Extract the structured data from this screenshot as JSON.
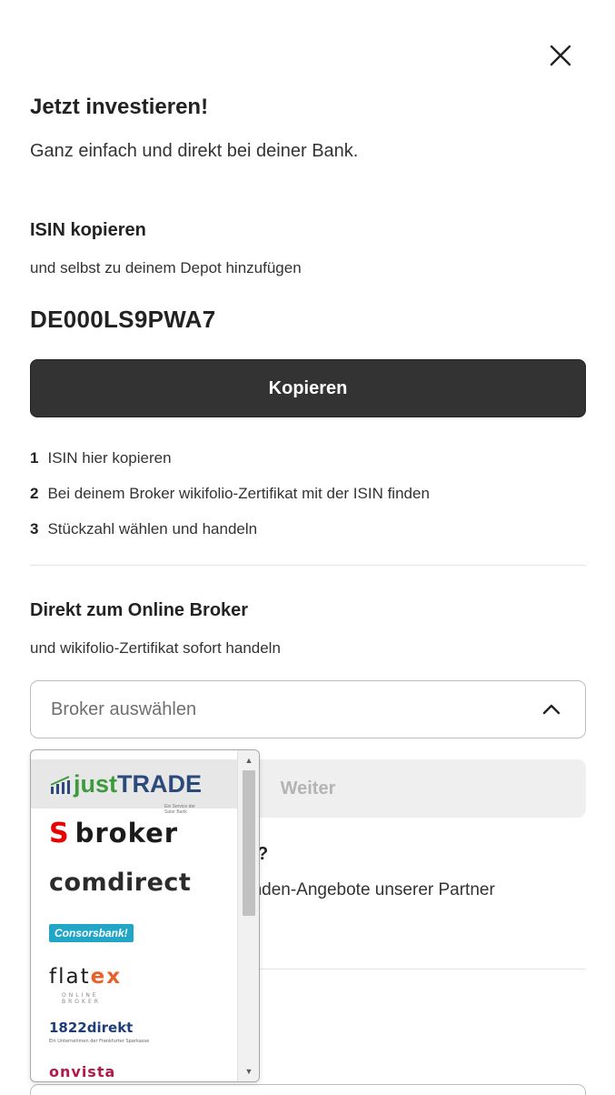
{
  "header": {
    "title": "Jetzt investieren!",
    "subtitle": "Ganz einfach und direkt bei deiner Bank.",
    "close_icon": "close-icon"
  },
  "isin_section": {
    "heading": "ISIN kopieren",
    "description": "und selbst zu deinem Depot hinzufügen",
    "isin": "DE000LS9PWA7",
    "copy_button": "Kopieren",
    "steps": [
      {
        "num": "1",
        "text": "ISIN hier kopieren"
      },
      {
        "num": "2",
        "text": "Bei deinem Broker wikifolio-Zertifikat mit der ISIN finden"
      },
      {
        "num": "3",
        "text": "Stückzahl wählen und handeln"
      }
    ]
  },
  "broker_section": {
    "heading": "Direkt zum Online Broker",
    "description": "und wikifolio-Zertifikat sofort handeln",
    "select_placeholder": "Broker auswählen",
    "select_icon": "chevron-up-icon",
    "weiter_button": "Weiter",
    "partially_hidden_heading_end": "?",
    "partially_hidden_text_end": "unden-Angebote unserer Partner"
  },
  "dropdown": {
    "options": [
      {
        "name": "justTRADE",
        "part1": "just",
        "part2": "TRADE",
        "tagline": "Ein Service der Sutor Bank",
        "selected": true
      },
      {
        "name": "broker",
        "label": "broker",
        "prefix": "S"
      },
      {
        "name": "comdirect",
        "label": "comdirect"
      },
      {
        "name": "Consorsbank",
        "label": "Consorsbank!"
      },
      {
        "name": "flatex",
        "part1": "flat",
        "part2": "ex",
        "sub": "ONLINE BROKER"
      },
      {
        "name": "1822direkt",
        "label": "1822direkt",
        "sub": "Ein Unternehmen der Frankfurter Sparkasse"
      },
      {
        "name": "onvista",
        "label": "onvista"
      }
    ]
  },
  "colors": {
    "button_dark": "#333333",
    "weiter_bg": "#efefef",
    "justtrade_green": "#3d9a3d",
    "sparkasse_red": "#e60000",
    "consors_blue": "#22a6c7",
    "flatex_orange": "#e8612a",
    "onvista_red": "#b21a4a"
  }
}
